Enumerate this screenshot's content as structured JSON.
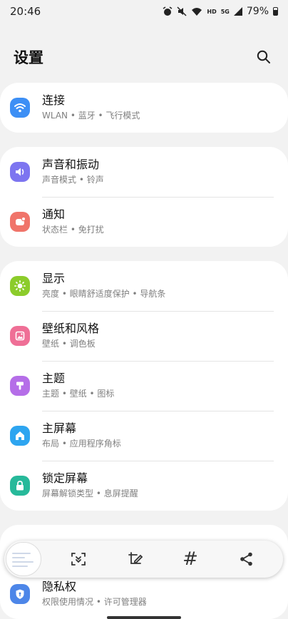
{
  "status": {
    "time": "20:46",
    "hd": "HD",
    "net": "5G",
    "battery": "79%"
  },
  "header": {
    "title": "设置"
  },
  "items": [
    {
      "title": "连接",
      "subtitle": "WLAN • 蓝牙 • 飞行模式",
      "icon": "wifi-icon",
      "color": "#3d8ff5"
    },
    {
      "title": "声音和振动",
      "subtitle": "声音模式 • 铃声",
      "icon": "volume-icon",
      "color": "#7d75f0"
    },
    {
      "title": "通知",
      "subtitle": "状态栏 • 免打扰",
      "icon": "notification-icon",
      "color": "#f0746a"
    },
    {
      "title": "显示",
      "subtitle": "亮度 • 眼睛舒适度保护 • 导航条",
      "icon": "brightness-icon",
      "color": "#8ccc2b"
    },
    {
      "title": "壁纸和风格",
      "subtitle": "壁纸 • 调色板",
      "icon": "wallpaper-icon",
      "color": "#ef6f96"
    },
    {
      "title": "主题",
      "subtitle": "主题 • 壁纸 • 图标",
      "icon": "theme-brush-icon",
      "color": "#b56ee8"
    },
    {
      "title": "主屏幕",
      "subtitle": "布局 • 应用程序角标",
      "icon": "home-icon",
      "color": "#2ea5f0"
    },
    {
      "title": "锁定屏幕",
      "subtitle": "屏幕解锁类型 • 息屏提醒",
      "icon": "lock-icon",
      "color": "#27b99a"
    },
    {
      "title": "隐私权",
      "subtitle": "权限使用情况 • 许可管理器",
      "icon": "privacy-shield-icon",
      "color": "#4d86e8"
    }
  ],
  "toolbar": {
    "hashtag": "#"
  }
}
